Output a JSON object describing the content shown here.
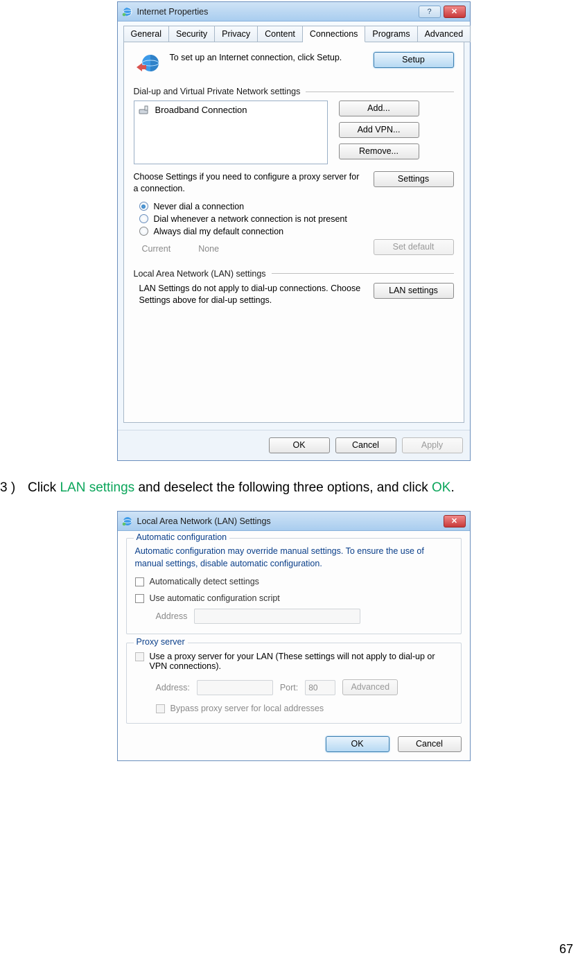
{
  "doc": {
    "page_number": "67",
    "step_number": "3 )",
    "instruction_parts": {
      "pre": "Click ",
      "hl1": "LAN settings",
      "mid": " and deselect the following three options, and click ",
      "hl2": "OK",
      "post": "."
    }
  },
  "win1": {
    "title": "Internet Properties",
    "help_glyph": "?",
    "close_glyph": "✕",
    "tabs": [
      "General",
      "Security",
      "Privacy",
      "Content",
      "Connections",
      "Programs",
      "Advanced"
    ],
    "setup_text": "To set up an Internet connection, click Setup.",
    "setup_btn": "Setup",
    "group_dial": "Dial-up and Virtual Private Network settings",
    "conn_item": "Broadband Connection",
    "btn_add": "Add...",
    "btn_addvpn": "Add VPN...",
    "btn_remove": "Remove...",
    "choose_text": "Choose Settings if you need to configure a proxy server for a connection.",
    "btn_settings": "Settings",
    "radio_never": "Never dial a connection",
    "radio_whenever": "Dial whenever a network connection is not present",
    "radio_always": "Always dial my default connection",
    "current_label": "Current",
    "current_value": "None",
    "btn_setdefault": "Set default",
    "group_lan": "Local Area Network (LAN) settings",
    "lan_text": "LAN Settings do not apply to dial-up connections. Choose Settings above for dial-up settings.",
    "btn_lan": "LAN settings",
    "btn_ok": "OK",
    "btn_cancel": "Cancel",
    "btn_apply": "Apply"
  },
  "win2": {
    "title": "Local Area Network (LAN) Settings",
    "close_glyph": "✕",
    "grp_auto": "Automatic configuration",
    "auto_text": "Automatic configuration may override manual settings.  To ensure the use of manual settings, disable automatic configuration.",
    "chk_auto_detect": "Automatically detect settings",
    "chk_auto_script": "Use automatic configuration script",
    "addr_label": "Address",
    "grp_proxy": "Proxy server",
    "chk_proxy_use": "Use a proxy server for your LAN (These settings will not apply to dial-up or VPN connections).",
    "addr2_label": "Address:",
    "port_label": "Port:",
    "port_value": "80",
    "btn_advanced": "Advanced",
    "chk_bypass": "Bypass proxy server for local addresses",
    "btn_ok": "OK",
    "btn_cancel": "Cancel"
  }
}
